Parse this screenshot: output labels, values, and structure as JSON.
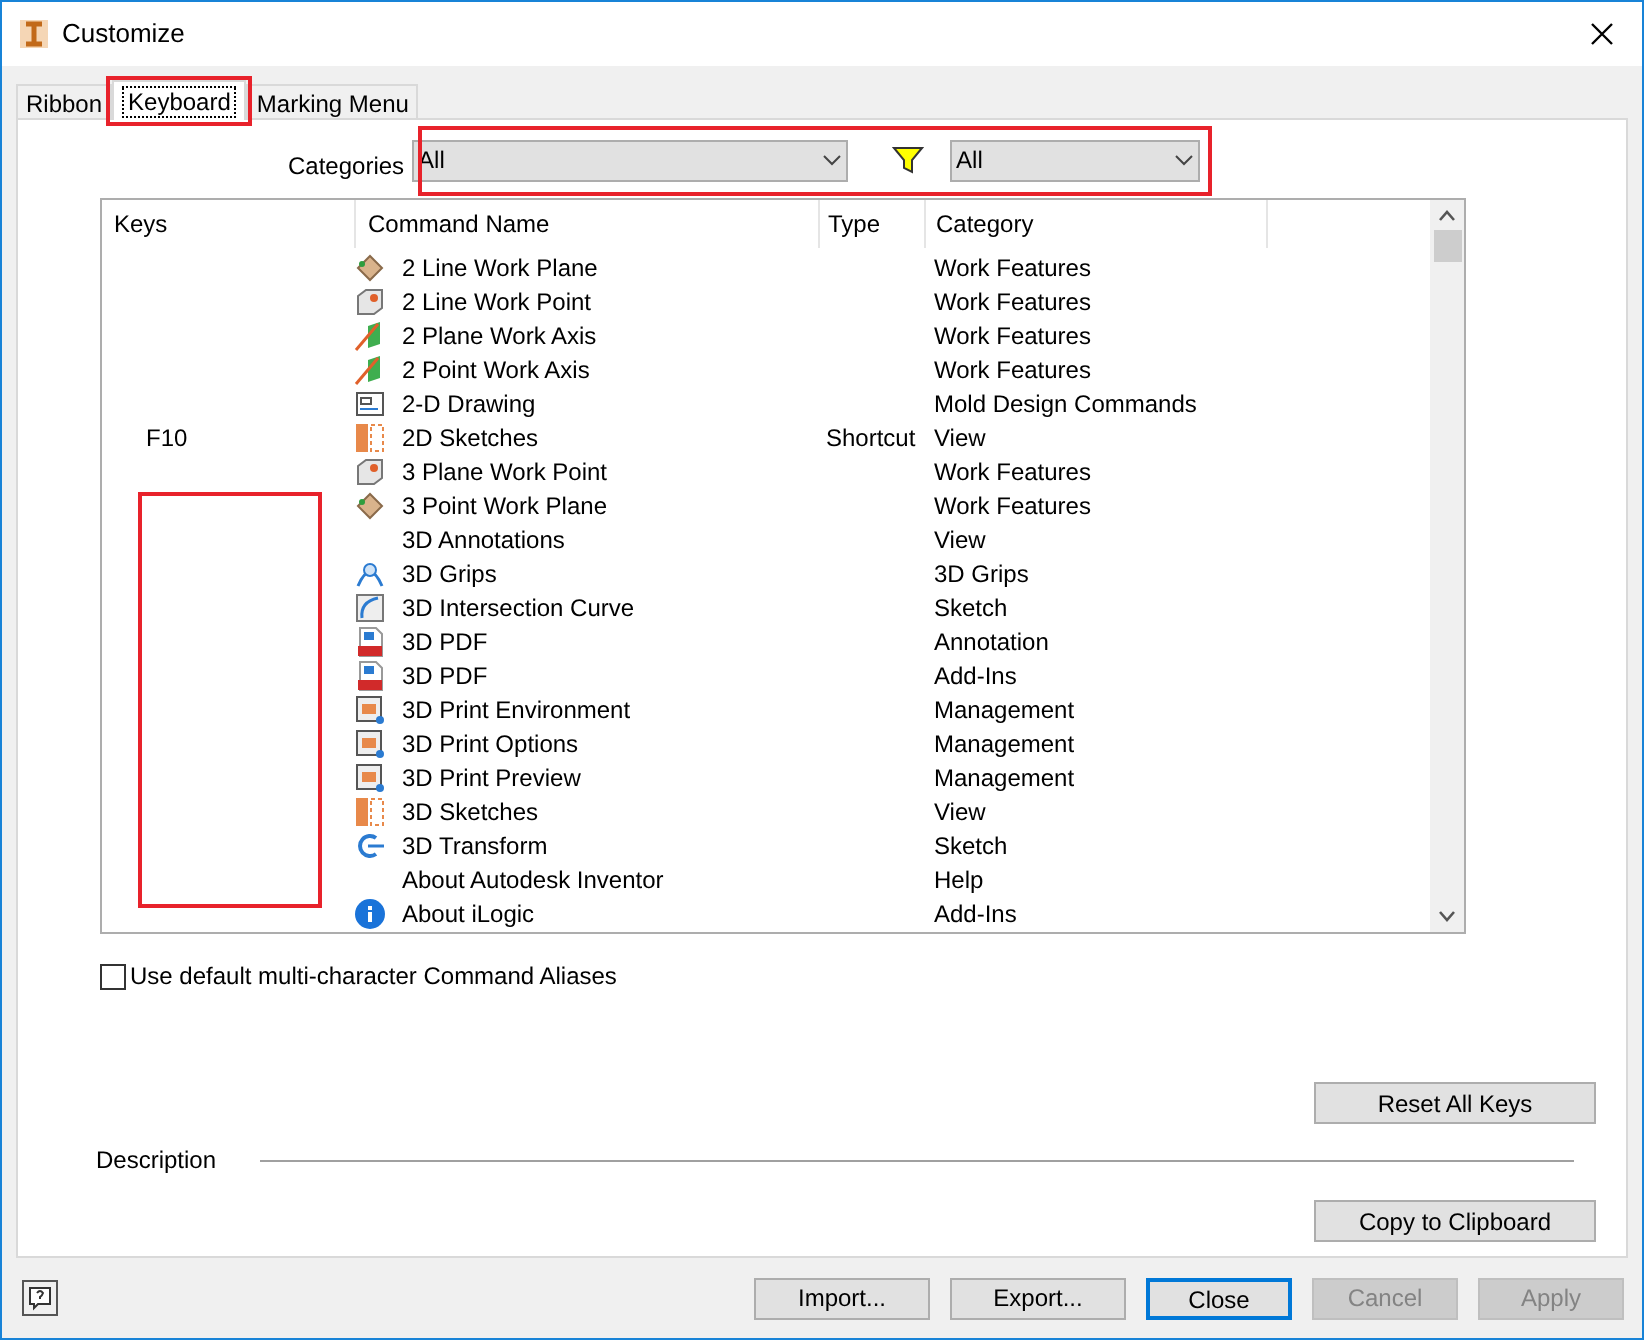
{
  "window": {
    "title": "Customize"
  },
  "tabs": [
    {
      "label": "Ribbon",
      "selected": false
    },
    {
      "label": "Keyboard",
      "selected": true
    },
    {
      "label": "Marking Menu",
      "selected": false
    }
  ],
  "categories": {
    "label": "Categories",
    "value": "All"
  },
  "filter": {
    "value": "All"
  },
  "table": {
    "columns": [
      "Keys",
      "Command Name",
      "Type",
      "Category"
    ],
    "rows": [
      {
        "kind": "plane",
        "keys": "",
        "name": "2 Line Work Plane",
        "type": "",
        "category": "Work Features"
      },
      {
        "kind": "point",
        "keys": "",
        "name": "2 Line Work Point",
        "type": "",
        "category": "Work Features"
      },
      {
        "kind": "axis",
        "keys": "",
        "name": "2 Plane Work Axis",
        "type": "",
        "category": "Work Features"
      },
      {
        "kind": "axis",
        "keys": "",
        "name": "2 Point Work Axis",
        "type": "",
        "category": "Work Features"
      },
      {
        "kind": "drawing",
        "keys": "",
        "name": "2-D Drawing",
        "type": "",
        "category": "Mold Design Commands"
      },
      {
        "kind": "sketch",
        "keys": "F10",
        "name": "2D Sketches",
        "type": "Shortcut",
        "category": "View"
      },
      {
        "kind": "point",
        "keys": "",
        "name": "3 Plane Work Point",
        "type": "",
        "category": "Work Features"
      },
      {
        "kind": "plane",
        "keys": "",
        "name": "3 Point Work Plane",
        "type": "",
        "category": "Work Features"
      },
      {
        "kind": "none",
        "keys": "",
        "name": "3D Annotations",
        "type": "",
        "category": "View"
      },
      {
        "kind": "grips",
        "keys": "",
        "name": "3D Grips",
        "type": "",
        "category": "3D Grips"
      },
      {
        "kind": "curve",
        "keys": "",
        "name": "3D Intersection Curve",
        "type": "",
        "category": "Sketch"
      },
      {
        "kind": "pdf",
        "keys": "",
        "name": "3D PDF",
        "type": "",
        "category": "Annotation"
      },
      {
        "kind": "pdf",
        "keys": "",
        "name": "3D PDF",
        "type": "",
        "category": "Add-Ins"
      },
      {
        "kind": "print",
        "keys": "",
        "name": "3D Print Environment",
        "type": "",
        "category": "Management"
      },
      {
        "kind": "print",
        "keys": "",
        "name": "3D Print Options",
        "type": "",
        "category": "Management"
      },
      {
        "kind": "print",
        "keys": "",
        "name": "3D Print Preview",
        "type": "",
        "category": "Management"
      },
      {
        "kind": "sketch",
        "keys": "",
        "name": "3D Sketches",
        "type": "",
        "category": "View"
      },
      {
        "kind": "transform",
        "keys": "",
        "name": "3D Transform",
        "type": "",
        "category": "Sketch"
      },
      {
        "kind": "none",
        "keys": "",
        "name": "About Autodesk Inventor",
        "type": "",
        "category": "Help"
      },
      {
        "kind": "info",
        "keys": "",
        "name": "About iLogic",
        "type": "",
        "category": "Add-Ins"
      }
    ]
  },
  "aliases_checkbox": {
    "label": "Use default multi-character Command Aliases",
    "checked": false
  },
  "reset_button": "Reset All Keys",
  "description_label": "Description",
  "copy_button": "Copy to Clipboard",
  "footer_buttons": [
    {
      "label": "Import...",
      "disabled": false,
      "default": false
    },
    {
      "label": "Export...",
      "disabled": false,
      "default": false
    },
    {
      "label": "Close",
      "disabled": false,
      "default": true
    },
    {
      "label": "Cancel",
      "disabled": true,
      "default": false
    },
    {
      "label": "Apply",
      "disabled": true,
      "default": false
    }
  ]
}
